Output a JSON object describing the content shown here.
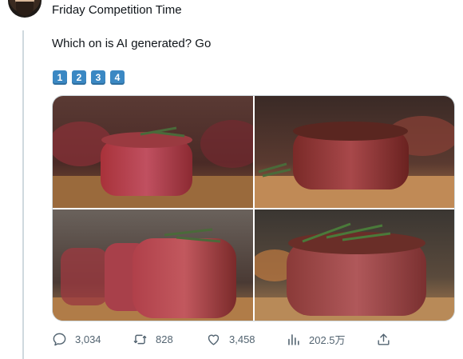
{
  "tweet": {
    "line1": "Friday Competition Time",
    "line2": "Which on is AI generated? Go",
    "keycaps": [
      "1",
      "2",
      "3",
      "4"
    ]
  },
  "media": {
    "photos": [
      {
        "icon": "steak-photo-1"
      },
      {
        "icon": "steak-photo-2"
      },
      {
        "icon": "steak-photo-3"
      },
      {
        "icon": "steak-photo-4"
      }
    ]
  },
  "actions": {
    "replies": "3,034",
    "retweets": "828",
    "likes": "3,458",
    "views": "202.5万"
  },
  "colors": {
    "keycap": "#3b88c3",
    "action_text": "#536471",
    "thread_line": "#cfd9de"
  }
}
